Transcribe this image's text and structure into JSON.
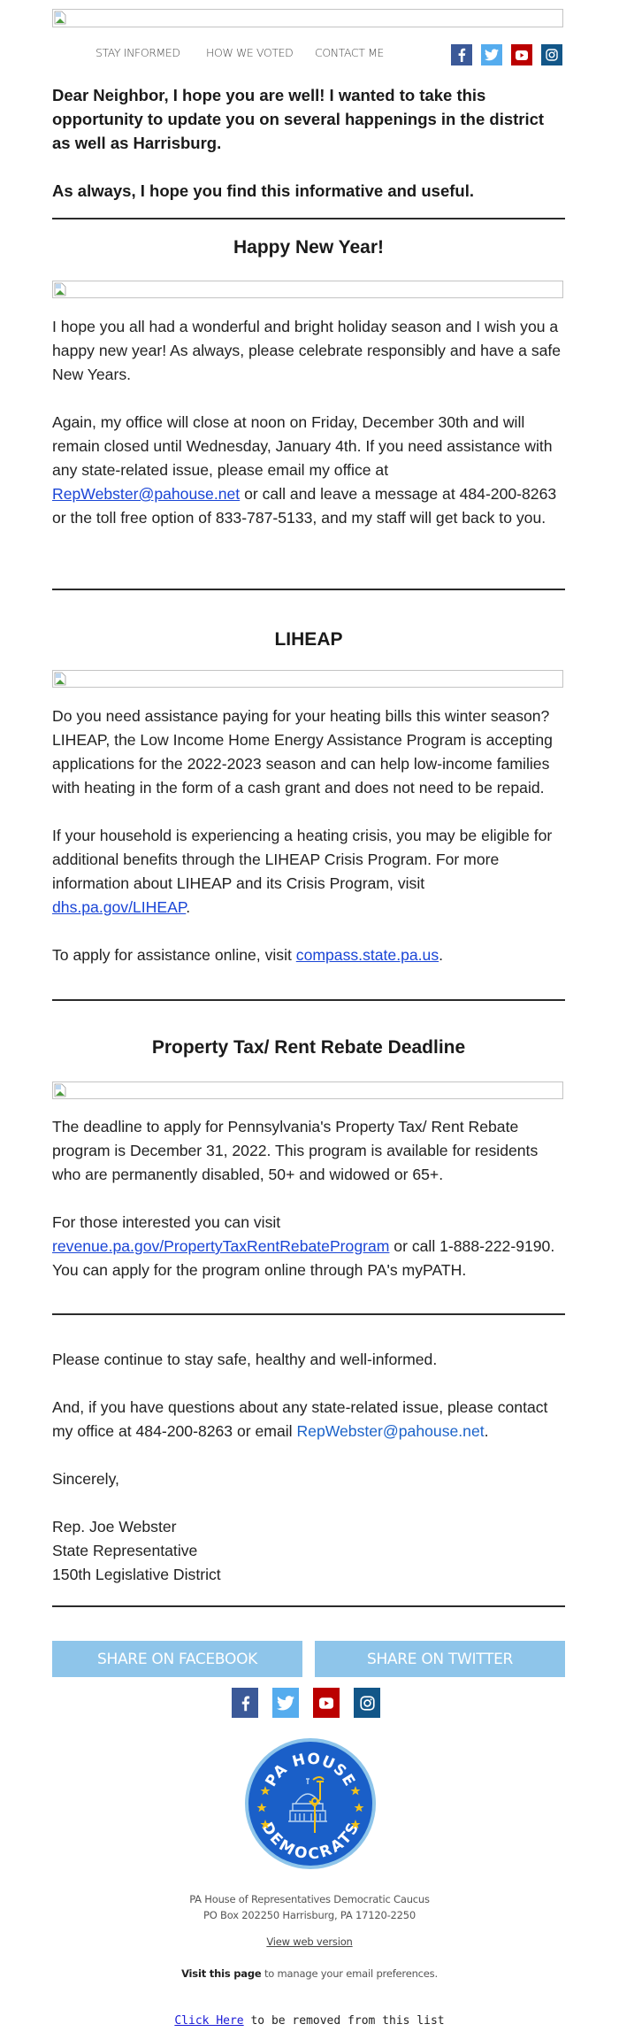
{
  "header": {
    "nav": [
      "STAY INFORMED",
      "HOW WE VOTED",
      "CONTACT ME"
    ],
    "social": [
      "facebook",
      "twitter",
      "youtube",
      "instagram"
    ]
  },
  "intro": {
    "line1": "Dear Neighbor, I hope you are well! I wanted to take this opportunity to update you on several happenings in the district as well as Harrisburg.",
    "line2": "As always, I hope you find this informative and useful."
  },
  "sections": [
    {
      "title": "Happy New Year!",
      "p1": "I hope you all had a wonderful and bright holiday season and I wish you a happy new year! As always, please celebrate responsibly and have a safe New Years.",
      "p2_before": "Again, my office will close at noon on Friday, December 30th and will remain closed until Wednesday, January 4th. If you need assistance with any state-related issue, please email my office at ",
      "p2_link": "RepWebster@pahouse.net",
      "p2_after": " or call and leave a message at 484-200-8263 or the toll free option of 833-787-5133, and my staff will get back to you."
    },
    {
      "title": "LIHEAP",
      "p1": "Do you need assistance paying for your heating bills this winter season? LIHEAP, the Low Income Home Energy Assistance Program is accepting applications for the 2022-2023 season and can help low-income families with heating in the form of a cash grant and does not need to be repaid.",
      "p2_before": "If your household is experiencing a heating crisis, you may be eligible for additional benefits through the LIHEAP Crisis Program. For more information about LIHEAP and its Crisis Program, visit ",
      "p2_link": "dhs.pa.gov/LIHEAP",
      "p2_after": ".",
      "p3_before": "To apply for assistance online, visit ",
      "p3_link": "compass.state.pa.us",
      "p3_after": "."
    },
    {
      "title": "Property Tax/ Rent Rebate Deadline",
      "p1": "The deadline to apply for Pennsylvania's Property Tax/ Rent Rebate program is December 31, 2022. This program is available for residents who are permanently disabled, 50+ and widowed or 65+.",
      "p2_before": "For those interested you can visit ",
      "p2_link": "revenue.pa.gov/PropertyTaxRentRebateProgram",
      "p2_after": " or call 1-888-222-9190. You can apply for the program online through PA's myPATH."
    }
  ],
  "closing": {
    "p1": "Please continue to stay safe, healthy and well-informed.",
    "p2_before": "And, if you have questions about any state-related issue, please contact my office at 484-200-8263 or email ",
    "p2_link": "RepWebster@pahouse.net",
    "p2_after": ".",
    "sincerely": "Sincerely,",
    "name": "Rep. Joe Webster",
    "role": "State Representative",
    "district": "150th Legislative District"
  },
  "share": {
    "facebook": "SHARE ON FACEBOOK",
    "twitter": "SHARE ON TWITTER"
  },
  "logo": {
    "top_text": "PA HOUSE",
    "bottom_text": "DEMOCRATS"
  },
  "footer": {
    "org": "PA House of Representatives Democratic Caucus",
    "address": "PO Box 202250 Harrisburg, PA 17120-2250",
    "web_version": "View web version",
    "prefs_bold": "Visit this page",
    "prefs_rest": " to manage your email preferences.",
    "unsub_link": "Click Here",
    "unsub_rest": " to be removed from this list"
  },
  "colors": {
    "facebook": "#3b5998",
    "twitter": "#55acee",
    "youtube": "#bb0000",
    "instagram": "#125688",
    "share_button": "#8ec5ea",
    "link": "#1a45d6",
    "logo_blue": "#1a5fc8",
    "logo_gold": "#f2c21b"
  }
}
